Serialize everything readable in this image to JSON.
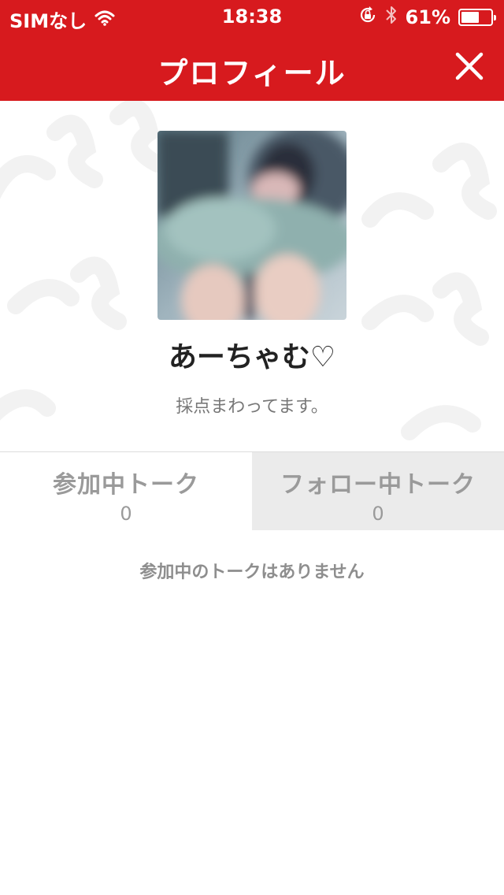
{
  "status_bar": {
    "carrier": "SIMなし",
    "time": "18:38",
    "battery": "61%",
    "battery_level": 0.61,
    "icons": [
      "wifi-icon",
      "rotation-lock-icon",
      "bluetooth-icon",
      "battery-icon"
    ]
  },
  "header": {
    "title": "プロフィール",
    "close_icon": "close-icon",
    "background_color": "#d71a1e"
  },
  "profile": {
    "name": "あーちゃむ♡",
    "bio": "採点まわってます。"
  },
  "tabs": [
    {
      "label": "参加中トーク",
      "count": "0",
      "selected": true
    },
    {
      "label": "フォロー中トーク",
      "count": "0",
      "selected": false
    }
  ],
  "empty_message": "参加中のトークはありません"
}
